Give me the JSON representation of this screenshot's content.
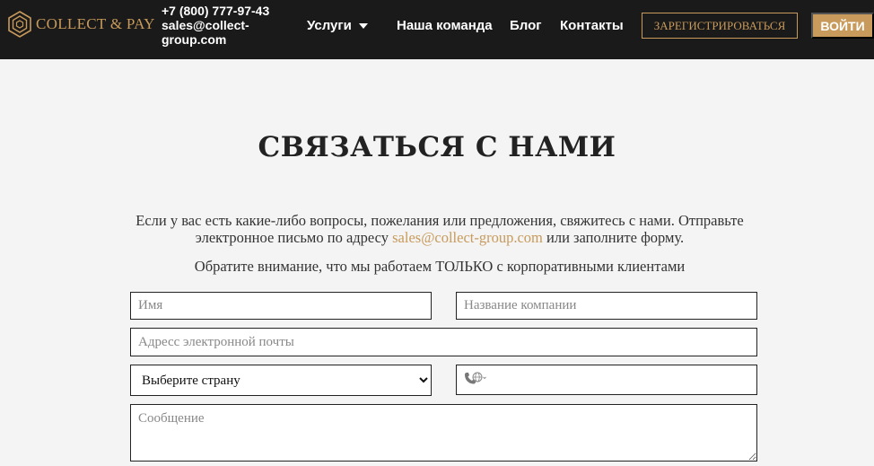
{
  "header": {
    "logo_text": "COLLECT & PAY",
    "phone": "+7 (800) 777-97-43",
    "email_line1": "sales@collect-",
    "email_line2": "group.com",
    "nav": {
      "services": "Услуги",
      "team": "Наша команда",
      "blog": "Блог",
      "contacts": "Контакты"
    },
    "register_label": "ЗАРЕГИСТРИРОВАТЬСЯ",
    "login_label": "ВОЙТИ"
  },
  "main": {
    "title": "СВЯЗАТЬСЯ С НАМИ",
    "intro_part1": "Если у вас есть какие-либо вопросы, пожелания или предложения, свяжитесь с нами. От­правьте электронное письмо по адресу ",
    "intro_email": "sales@collect-group.com",
    "intro_part2": " или заполните форму.",
    "notice": "Обратите внимание, что мы работаем ТОЛЬКО с корпоративными клиентами"
  },
  "form": {
    "name_placeholder": "Имя",
    "company_placeholder": "Название компании",
    "email_placeholder": "Адресс электронной почты",
    "country_selected": "Выберите страну",
    "phone_value": "",
    "message_placeholder": "Сообщение"
  },
  "colors": {
    "accent": "#c89a5b",
    "header_bg": "#1a1a1a",
    "page_bg": "#f4f4f4"
  },
  "icons": {
    "logo": "hexagon-logo-icon",
    "services_dropdown": "chevron-down-icon",
    "phone": "phone-globe-icon"
  }
}
